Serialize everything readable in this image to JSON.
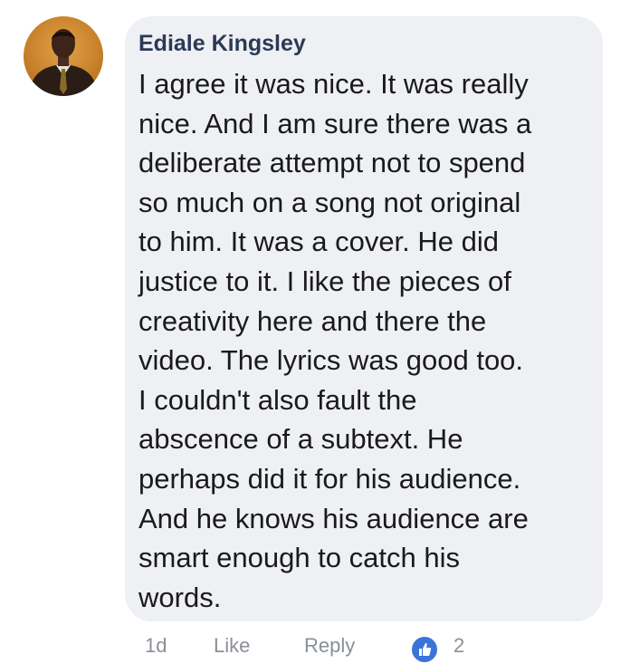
{
  "comment": {
    "author": "Ediale Kingsley",
    "lines": [
      "I agree it was nice. It was really",
      "nice. And I am sure there was a",
      "deliberate attempt not to spend",
      "so much on a song not original",
      "to him. It was a cover. He did",
      "justice to it. I like the pieces of",
      "creativity here and there the",
      "video. The lyrics was good too.",
      "I couldn't also fault the",
      "abscence of a subtext. He",
      "perhaps did it for his audience.",
      "And he knows his audience are",
      "smart enough to catch his",
      "words."
    ],
    "avatar_icon": "user-avatar-photo"
  },
  "actions": {
    "time": "1d",
    "like_label": "Like",
    "reply_label": "Reply",
    "reaction_icon": "like-thumb-icon",
    "reaction_count": "2"
  },
  "colors": {
    "bubble": "#eef0f3",
    "author": "#2b3a55",
    "text": "#1a1a1a",
    "meta": "#8a8f96",
    "reaction": "#3b74d9"
  }
}
